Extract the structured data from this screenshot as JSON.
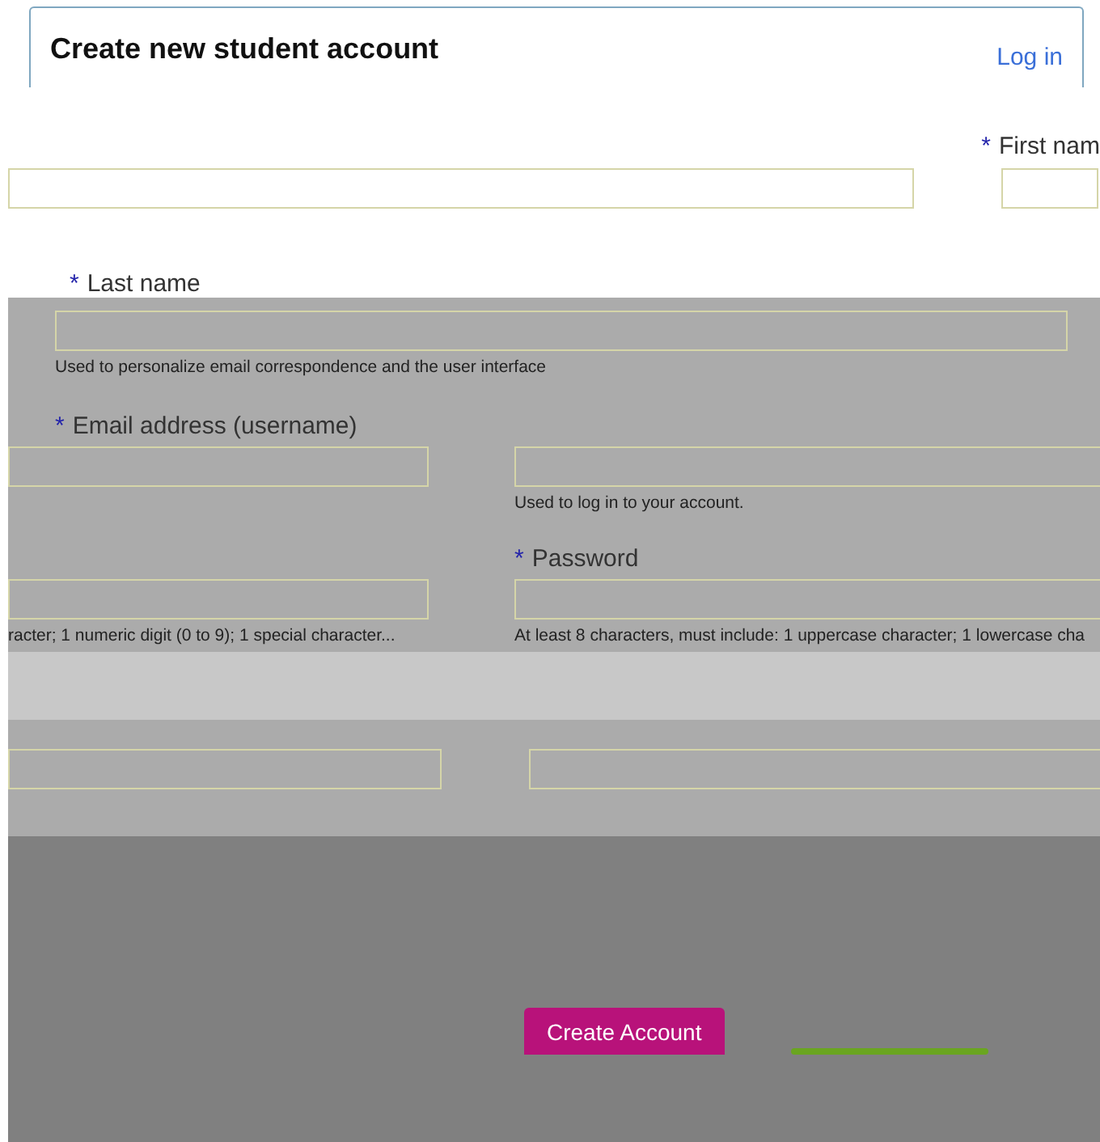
{
  "header": {
    "title": "Create new student account",
    "login_link": "Log in"
  },
  "first_name": {
    "marker": "*",
    "label": "First nam"
  },
  "last_name": {
    "marker": "*",
    "label": "Last name",
    "help": "Used to personalize email correspondence and the user interface"
  },
  "email": {
    "marker": "*",
    "label": "Email address (username)",
    "help": "Used to log in to your account."
  },
  "password": {
    "marker": "*",
    "label": "Password",
    "help": "At least 8 characters, must include: 1 uppercase character; 1 lowercase cha"
  },
  "left_help": "racter; 1 numeric digit (0 to 9); 1 special character...",
  "submit": {
    "label": "Create Account"
  }
}
